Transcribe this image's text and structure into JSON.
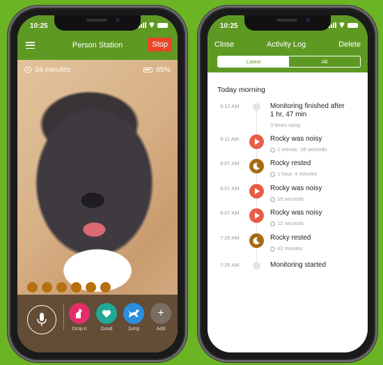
{
  "status_bar": {
    "time": "10:25"
  },
  "left_screen": {
    "title": "Person Station",
    "stop_label": "Stop",
    "duration": "34 minutes",
    "battery": "85%",
    "dots_count": 6,
    "actions": [
      {
        "label": "Drop it",
        "icon": "dog-sit-icon",
        "color": "#e62d6b"
      },
      {
        "label": "Good",
        "icon": "heart-icon",
        "color": "#1fa896"
      },
      {
        "label": "Jump",
        "icon": "dog-jump-icon",
        "color": "#2b8fe0"
      },
      {
        "label": "Add",
        "icon": "plus-icon",
        "color": "#7a6e64"
      }
    ]
  },
  "right_screen": {
    "close_label": "Close",
    "title": "Activity Log",
    "delete_label": "Delete",
    "tabs": [
      {
        "label": "Latest",
        "active": true
      },
      {
        "label": "All",
        "active": false
      }
    ],
    "section_title": "Today morning",
    "entries": [
      {
        "time": "9:12 AM",
        "title": "Monitoring finished after 1 hr, 47 min",
        "subtitle": "3 times noisy",
        "type": "status"
      },
      {
        "time": "9:11 AM",
        "title": "Rocky was noisy",
        "subtitle": "1 minute, 18 seconds",
        "type": "noisy"
      },
      {
        "time": "8:07 AM",
        "title": "Rocky rested",
        "subtitle": "1 hour, 4 minutes",
        "type": "rested"
      },
      {
        "time": "8:07 AM",
        "title": "Rocky was noisy",
        "subtitle": "19 seconds",
        "type": "noisy"
      },
      {
        "time": "8:07 AM",
        "title": "Rocky was noisy",
        "subtitle": "12 seconds",
        "type": "noisy"
      },
      {
        "time": "7:25 AM",
        "title": "Rocky rested",
        "subtitle": "42 minutes",
        "type": "rested"
      },
      {
        "time": "7:25 AM",
        "title": "Monitoring started",
        "subtitle": "",
        "type": "status"
      }
    ],
    "colors": {
      "noisy": "#e85d45",
      "rested": "#a86a12",
      "accent": "#5e9a23"
    }
  }
}
